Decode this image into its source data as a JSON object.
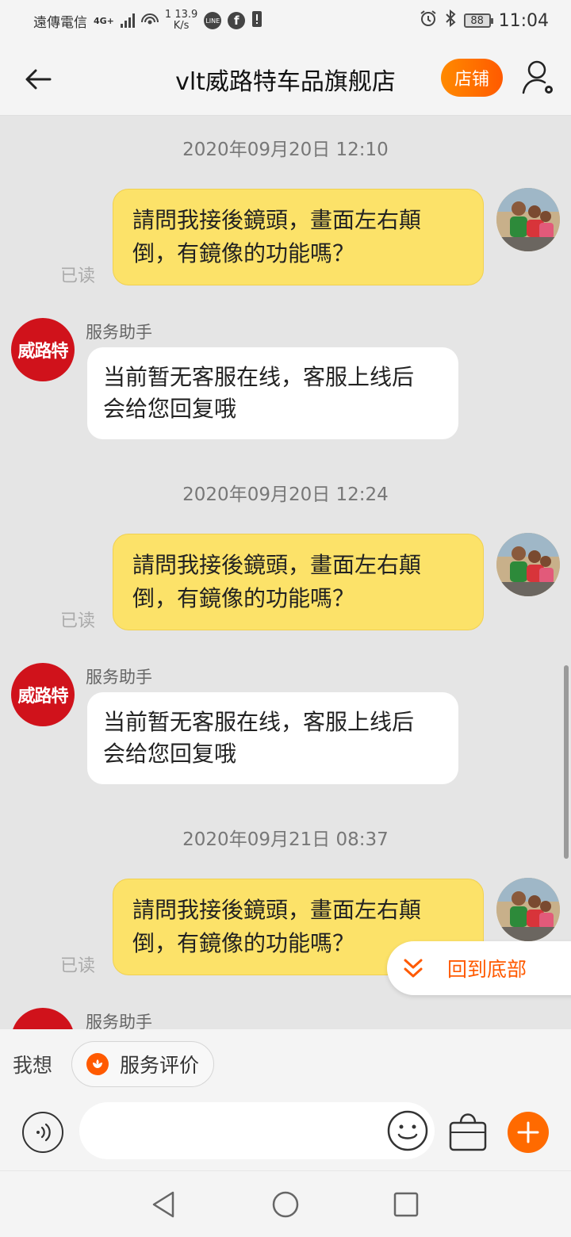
{
  "status_bar": {
    "carrier": "遠傳電信",
    "network": "4G+",
    "speed_value": "13.9",
    "speed_unit": "K/s",
    "speed_prefix": "1",
    "battery": "88",
    "time": "11:04",
    "icons": [
      "signal-icon",
      "hotspot-icon",
      "line-icon",
      "facebook-icon",
      "alert-icon",
      "alarm-icon",
      "bluetooth-icon",
      "battery-icon"
    ]
  },
  "header": {
    "title": "vlt威路特车品旗舰店",
    "shop_button": "店铺",
    "back_icon": "back-arrow-icon",
    "user_icon": "user-settings-icon"
  },
  "messages": [
    {
      "timestamp": "2020年09月20日 12:10",
      "outgoing": {
        "line1": "請問我接後鏡頭，畫面左右顛",
        "line2": "倒，有鏡像的功能嗎？",
        "status": "已读"
      },
      "incoming": {
        "sender": "服务助手",
        "line1": "当前暂无客服在线，客服上线后",
        "line2": "会给您回复哦"
      }
    },
    {
      "timestamp": "2020年09月20日 12:24",
      "outgoing": {
        "line1": "請問我接後鏡頭，畫面左右顛",
        "line2": "倒，有鏡像的功能嗎？",
        "status": "已读"
      },
      "incoming": {
        "sender": "服务助手",
        "line1": "当前暂无客服在线，客服上线后",
        "line2": "会给您回复哦"
      }
    },
    {
      "timestamp": "2020年09月21日 08:37",
      "outgoing": {
        "line1": "請問我接後鏡頭，畫面左右顛",
        "line2": "倒，有鏡像的功能嗎？",
        "status": "已读"
      },
      "incoming": {
        "sender": "服务助手"
      }
    }
  ],
  "shop_avatar_text": "威路特",
  "back_to_bottom": "回到底部",
  "quick_bar": {
    "label": "我想",
    "chip": "服务评价"
  },
  "input": {
    "placeholder": "",
    "value": ""
  },
  "colors": {
    "accent": "#ff6a00",
    "outgoing_bubble": "#fce269",
    "incoming_bubble": "#ffffff",
    "shop_avatar": "#d0121b"
  }
}
